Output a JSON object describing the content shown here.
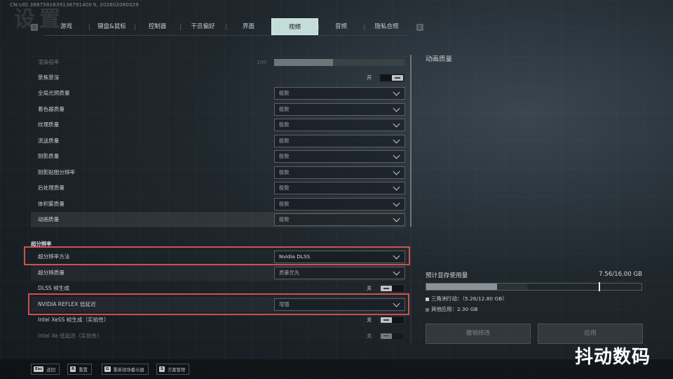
{
  "header": {
    "cn_uid": "CN:UID 3687581639138791400 9, 202602080029",
    "page_title_ghost": "设置",
    "tabs_key_left": "Q",
    "tabs_key_right": "E",
    "tabs": [
      "游戏",
      "键盘&鼠标",
      "控制器",
      "干员偏好",
      "界面",
      "视频",
      "音频",
      "隐私合规"
    ],
    "active_tab": "视频"
  },
  "settings": {
    "render_scale": {
      "label": "渲染倍率",
      "value": "100",
      "fill_fraction": 0.45
    },
    "depth_of_field": {
      "label": "景焦景深",
      "state": "开"
    },
    "rows": [
      {
        "label": "全局光照质量",
        "value": "极致"
      },
      {
        "label": "着色器质量",
        "value": "极致"
      },
      {
        "label": "纹理质量",
        "value": "极致"
      },
      {
        "label": "流送质量",
        "value": "极致"
      },
      {
        "label": "阴影质量",
        "value": "极致"
      },
      {
        "label": "阴影贴图分辨率",
        "value": "极致"
      },
      {
        "label": "后处理质量",
        "value": "极致"
      },
      {
        "label": "体积雾质量",
        "value": "极致"
      },
      {
        "label": "动画质量",
        "value": "极致"
      }
    ],
    "section_super_res": "超分辨率",
    "upscale_method": {
      "label": "超分辨率方法",
      "value": "Nvidia DLSS"
    },
    "upscale_quality": {
      "label": "超分辨质量",
      "value": "质量优先"
    },
    "dlss_framegen": {
      "label": "DLSS 帧生成",
      "state": "关"
    },
    "reflex": {
      "label": "NVIDIA REFLEX 低延迟",
      "value": "增强"
    },
    "xess_framegen": {
      "label": "Intel XeSS 帧生成（实验性）",
      "state": "关"
    },
    "xe_low_latency": {
      "label": "Intel Xe 低延迟（实验性）",
      "state": "关"
    }
  },
  "right_panel": {
    "title": "动画质量",
    "vram_label": "预计显存使用量",
    "vram_total": "7.56/16.00 GB",
    "vram_game_fraction": 0.33,
    "vram_other_fraction": 0.14,
    "vram_marker_fraction": 0.8,
    "legend_game": "三角洲行动：（5.26/12.80 GB）",
    "legend_other": "其他应用：2.30 GB",
    "revert_button": "撤销修改",
    "apply_button": "应用",
    "colors": {
      "game": "#8c9398",
      "other": "#2b3236",
      "highlight_box": "#d0504d"
    }
  },
  "footer": [
    {
      "key": "Esc",
      "label": "返回"
    },
    {
      "key": "R",
      "label": "重置"
    },
    {
      "key": "G",
      "label": "重新现场番示器"
    },
    {
      "key": "S",
      "label": "方案管理"
    }
  ],
  "watermark": "抖动数码"
}
